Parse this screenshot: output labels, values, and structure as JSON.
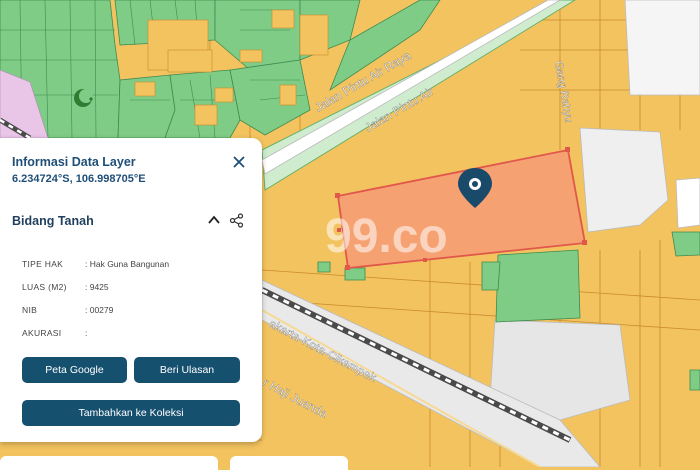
{
  "map": {
    "streets": {
      "jalan_pintu_air_raya": "Jalan Pintu Air Raya",
      "jalan_pintu_air": "Jalan Pintu Air",
      "gang_rahyu": "Gang Rahyu",
      "jalan_hajuanda": "r Haji Juanda",
      "kota_clampek": "akarta-Kota-Cikampek"
    },
    "watermark": "99.co",
    "colors": {
      "parcel_yellow": "#f3c35f",
      "parcel_green": "#7fcc86",
      "selected_parcel": "#f6a172",
      "marker": "#1a4a6a"
    }
  },
  "panel": {
    "title": "Informasi Data Layer",
    "coords": "6.234724°S, 106.998705°E",
    "section": "Bidang Tanah",
    "rows": [
      {
        "label": "TIPE HAK",
        "value": ": Hak Guna Bangunan"
      },
      {
        "label": "LUAS (M2)",
        "value": ": 9425"
      },
      {
        "label": "NIB",
        "value": ": 00279"
      },
      {
        "label": "AKURASI",
        "value": ":"
      }
    ],
    "buttons": {
      "google": "Peta Google",
      "review": "Beri Ulasan",
      "collection": "Tambahkan ke Koleksi"
    }
  }
}
